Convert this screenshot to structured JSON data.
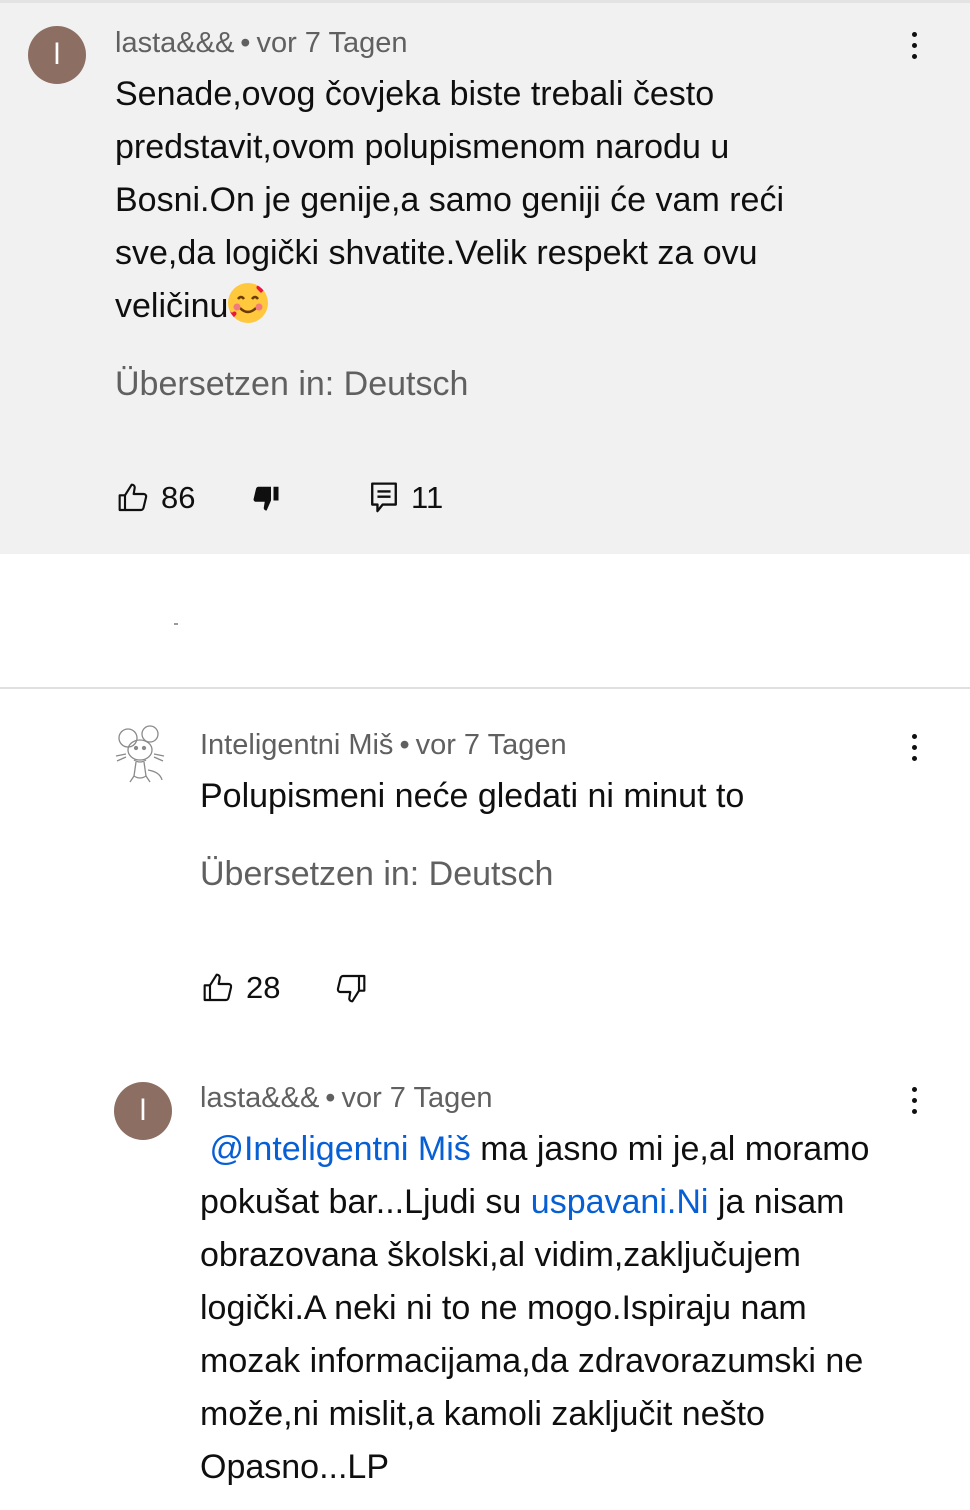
{
  "main_comment": {
    "avatar_letter": "l",
    "author": "lasta&&&",
    "time": "vor 7 Tagen",
    "text": "Senade,ovog čovjeka biste trebali često predstavit,ovom polupismenom narodu u Bosni.On je genije,a samo geniji će vam reći sve,da logički shvatite.Velik respekt za ovu veličinu",
    "emoji": "smiling-face-with-hearts",
    "translate": "Übersetzen in: Deutsch",
    "likes": "86",
    "replies": "11"
  },
  "reply_1": {
    "author": "Inteligentni Miš",
    "time": "vor 7 Tagen",
    "text": "Polupismeni neće gledati ni minut to",
    "translate": "Übersetzen in: Deutsch",
    "likes": "28"
  },
  "reply_2": {
    "avatar_letter": "l",
    "author": "lasta&&&",
    "time": "vor 7 Tagen",
    "mention": "@Inteligentni Miš",
    "text_a": " ma jasno mi je,al moramo pokušat bar...Ljudi su ",
    "link": "uspavani.Ni",
    "text_b": " ja nisam obrazovana školski,al vidim,zaključujem logički.A neki ni to ne mogo.Ispiraju nam mozak informacijama,da zdravorazumski ne može,ni mislit,a kamoli zaključit nešto Opasno...LP"
  },
  "colors": {
    "highlight_bg": "#f1f1f1",
    "avatar": "#8d6e63",
    "link": "#065fd4",
    "secondary_text": "#606060"
  },
  "icons": [
    "more-vert-icon",
    "thumb-up-icon",
    "thumb-down-filled-icon",
    "thumb-down-icon",
    "reply-comment-icon"
  ]
}
